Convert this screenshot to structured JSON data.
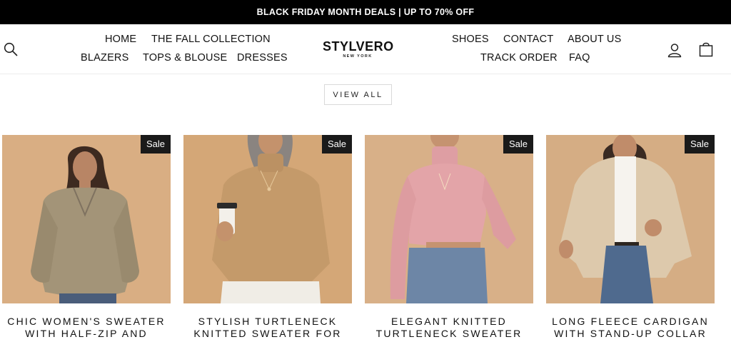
{
  "announcement": "BLACK FRIDAY MONTH DEALS | UP TO 70% OFF",
  "nav_left_row1": [
    "HOME",
    "THE FALL COLLECTION"
  ],
  "nav_left_row2": [
    "BLAZERS",
    "TOPS & BLOUSE",
    "DRESSES"
  ],
  "nav_right_row1": [
    "SHOES",
    "CONTACT",
    "ABOUT US"
  ],
  "nav_right_row2": [
    "TRACK ORDER",
    "FAQ"
  ],
  "logo": {
    "name": "STYLVERO",
    "sub": "NEW YORK"
  },
  "icons": {
    "search": "search-icon",
    "account": "user-icon",
    "cart": "bag-icon"
  },
  "view_all": "VIEW ALL",
  "products": [
    {
      "badge": "Sale",
      "title_line1": "CHIC WOMEN'S SWEATER",
      "title_line2": "WITH HALF-ZIP AND",
      "bg": "#d9ae83",
      "garment": "#a39478"
    },
    {
      "badge": "Sale",
      "title_line1": "STYLISH TURTLENECK",
      "title_line2": "KNITTED SWEATER FOR",
      "bg": "#d4a777",
      "garment": "#c49a6a"
    },
    {
      "badge": "Sale",
      "title_line1": "ELEGANT KNITTED",
      "title_line2": "TURTLENECK SWEATER",
      "bg": "#d8b088",
      "garment": "#e3a4a8"
    },
    {
      "badge": "Sale",
      "title_line1": "LONG FLEECE CARDIGAN",
      "title_line2": "WITH STAND-UP COLLAR",
      "bg": "#d5ad84",
      "garment": "#ddc9ac"
    }
  ]
}
